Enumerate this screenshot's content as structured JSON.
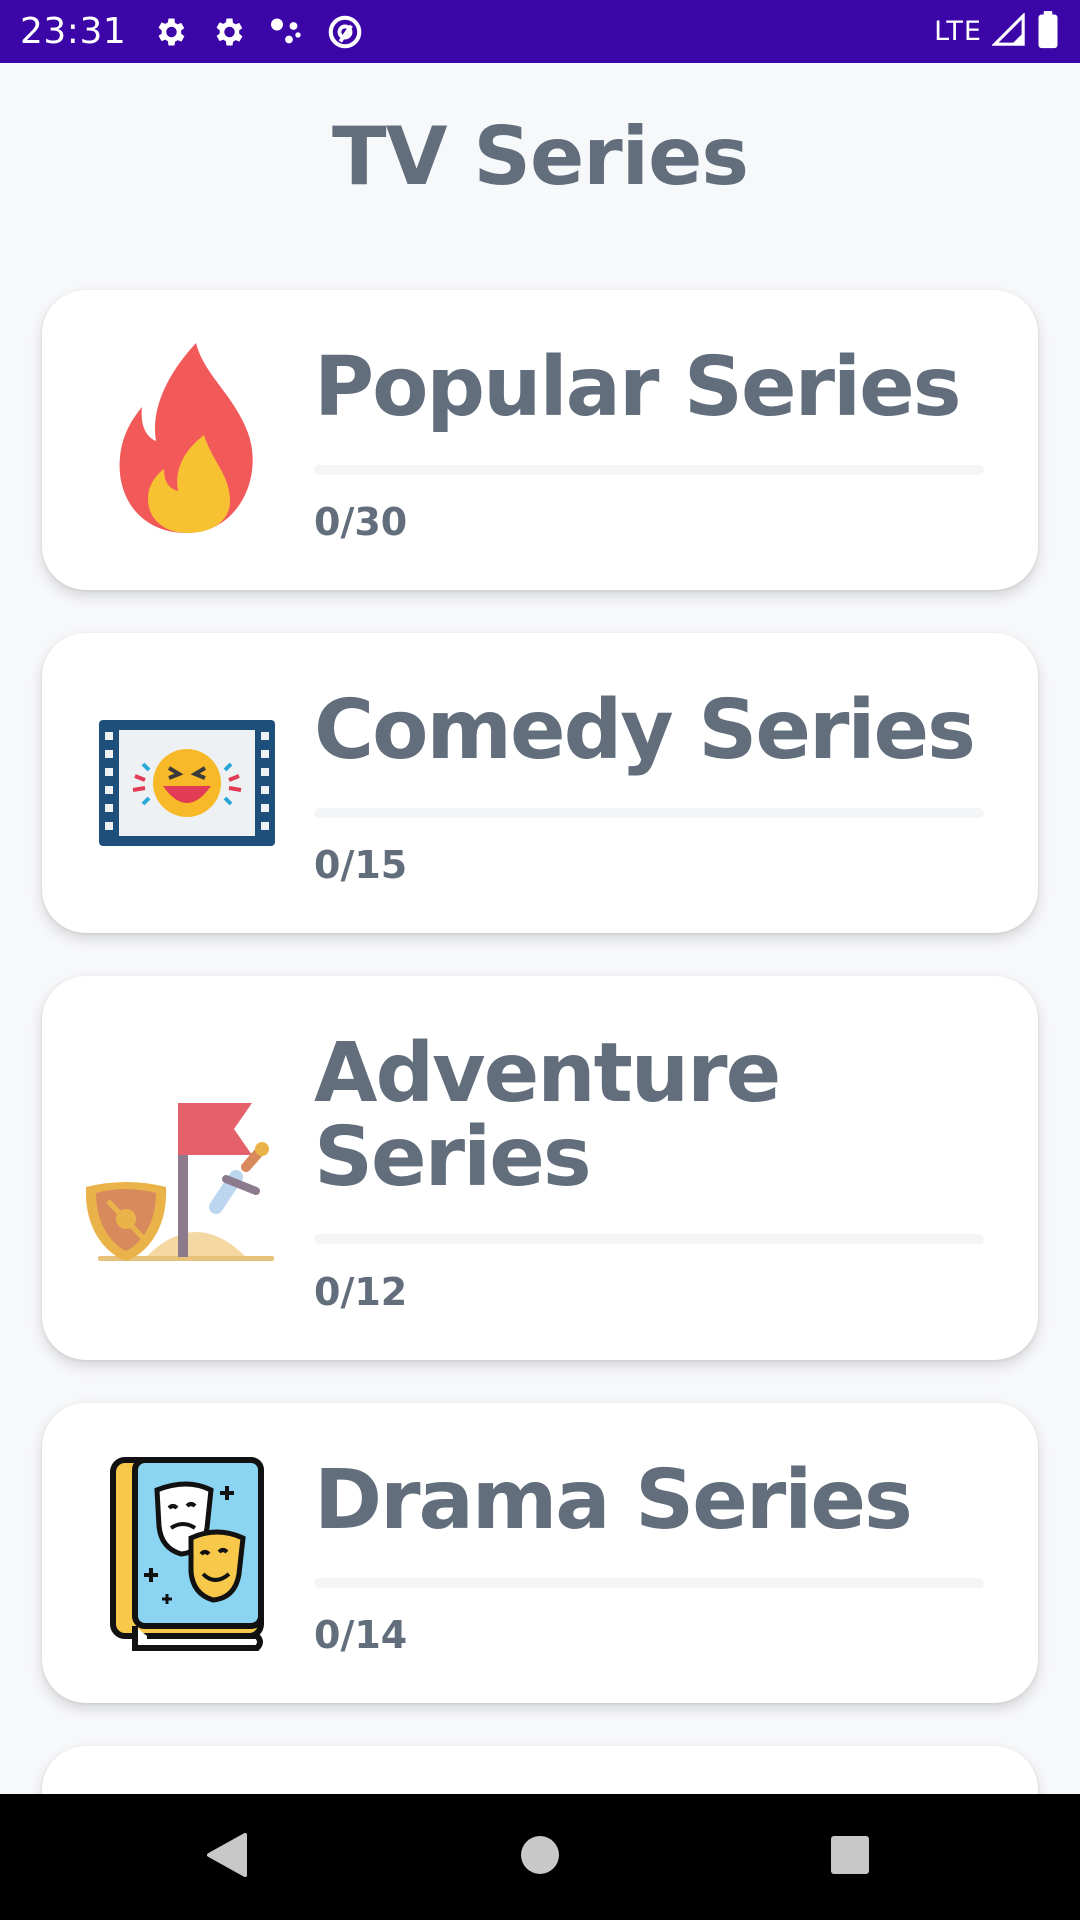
{
  "status_bar": {
    "time": "23:31",
    "network": "LTE",
    "icons": [
      "settings-icon",
      "settings-icon",
      "assistant-dots-icon",
      "at-sign-icon",
      "signal-icon",
      "battery-icon"
    ],
    "background": "#3c05a8"
  },
  "header": {
    "title": "TV Series"
  },
  "categories": [
    {
      "title": "Popular Series",
      "count": "0/30",
      "progress": 0,
      "icon": "fire-icon"
    },
    {
      "title": "Comedy Series",
      "count": "0/15",
      "progress": 0,
      "icon": "comedy-film-icon"
    },
    {
      "title": "Adventure Series",
      "count": "0/12",
      "progress": 0,
      "icon": "adventure-flag-icon"
    },
    {
      "title": "Drama Series",
      "count": "0/14",
      "progress": 0,
      "icon": "drama-book-icon"
    }
  ],
  "nav_bar": {
    "icons": [
      "back-icon",
      "home-icon",
      "recents-icon"
    ]
  },
  "colors": {
    "text": "#626e7c",
    "card": "#ffffff",
    "page_bg": "#f7f8fa",
    "status_bar": "#3c05a8",
    "nav_bar": "#000000"
  }
}
